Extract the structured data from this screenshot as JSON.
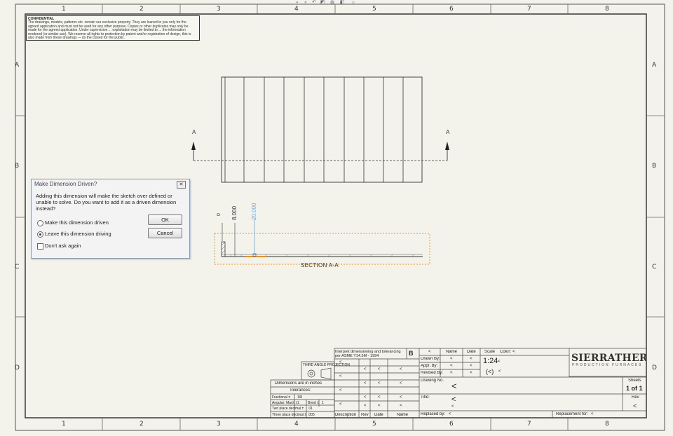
{
  "toolbar": {
    "icons": [
      "zoom-fit-icon",
      "zoom-area-icon",
      "previous-view-icon",
      "section-view-icon",
      "display-style-icon",
      "hide-show-icon",
      "apply-scene-icon"
    ]
  },
  "ruler": {
    "columns": [
      "1",
      "2",
      "3",
      "4",
      "5",
      "6",
      "7",
      "8"
    ],
    "rows": [
      "A",
      "B",
      "C",
      "D"
    ]
  },
  "confidential": {
    "heading": "CONFIDENTIAL",
    "body": "The drawings, models, patterns etc. remain our exclusive property. They are loaned to you only for the agreed application and must not be used for any other purpose. Copies or other duplicates may only be made for the agreed application. Under supervision ... exploitation may be limited to ... the information rendered (or similar use). We reserve all rights to protection by patent and/or registration of design, this is also made from these drawings — its the closed for the public."
  },
  "drawing": {
    "section_mark_left": "A",
    "section_mark_right": "A",
    "section_label": "SECTION A-A",
    "dim_zero": "0",
    "dim_value": "8.000",
    "dim_driving": "20.000"
  },
  "dialog": {
    "title": "Make Dimension Driven?",
    "message": "Adding this dimension will make the sketch over defined or unable to solve.  Do you want to add it as a driven dimension instead?",
    "option_driven": "Make this dimension driven",
    "option_driving": "Leave this dimension driving",
    "selected": "driving",
    "dont_ask": "Don't ask again",
    "ok": "OK",
    "cancel": "Cancel"
  },
  "title_block": {
    "interpret": "Interpret dimensioning and tolerancing per ASME Y14.5M - 1994",
    "rev_letter": "B",
    "dims_in": "Dimensions are in inches",
    "tolerances": "Tolerances:",
    "fractions": "Fractional ±",
    "fraction_val": "1/8",
    "angular": "Angular: Mach ±",
    "angular_val": "1",
    "bend": "Bend ±",
    "bend_val": "1",
    "two_place": "Two place decimal ±",
    "two_place_val": ".01",
    "three_place": "Three place decimal ±",
    "three_place_val": ".005",
    "third_angle": "THIRD ANGLE PROJECTION",
    "col_name": "Name",
    "col_date": "Date",
    "drawn_by": "Drawn By:",
    "appr_by": "Appr. By:",
    "revised_by": "Revised By:",
    "placeholder": "<",
    "scale_label": "Scale",
    "scale_value": "1:24",
    "color_label": "Color:",
    "paren_val": "(<)",
    "drawing_no": "Drawing No.",
    "title_label": "Title:",
    "sheets_label": "Sheets",
    "sheets_value": "1 of 1",
    "rev_label": "Rev",
    "replaced_by": "Replaced by:",
    "replacement_for": "Replacement for:",
    "desc": "Description",
    "rev": "Rev",
    "date": "Date",
    "name": "Name",
    "company": "SIERRATHERM",
    "company_sub": "PRODUCTION FURNACES"
  },
  "colors": {
    "sheet_bg": "#f3f3ec",
    "line": "#333333",
    "selection": "#e8902a",
    "driving_dim": "#6aa6d8"
  }
}
